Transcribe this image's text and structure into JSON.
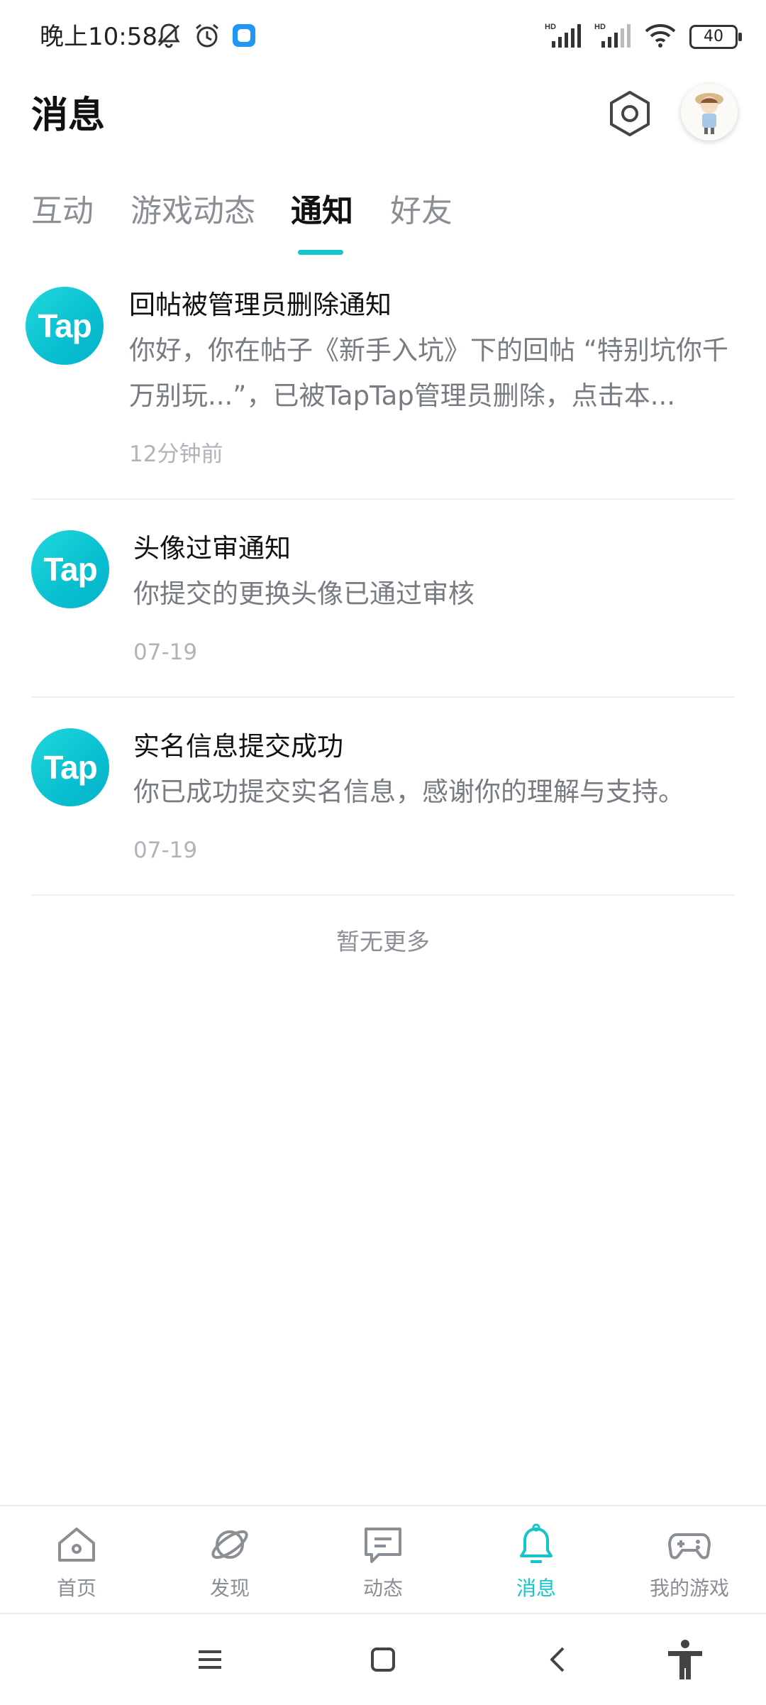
{
  "status_bar": {
    "time": "晚上10:58",
    "left_icons": [
      "bell-off-icon",
      "alarm-icon",
      "app-notification-icon"
    ],
    "right_icons": [
      "hd-signal-1-icon",
      "hd-signal-2-icon",
      "wifi-icon"
    ],
    "battery": "40"
  },
  "header": {
    "title": "消息",
    "settings_icon": "settings-hexagon-icon",
    "avatar": "user-avatar"
  },
  "tabs": [
    {
      "label": "互动",
      "active": false
    },
    {
      "label": "游戏动态",
      "active": false
    },
    {
      "label": "通知",
      "active": true
    },
    {
      "label": "好友",
      "active": false
    }
  ],
  "notifications": [
    {
      "logo": "Tap",
      "title": "回帖被管理员删除通知",
      "body": "你好，你在帖子《新手入坑》下的回帖 “特别坑你千万别玩...”，已被TapTap管理员删除，点击本...",
      "time": "12分钟前"
    },
    {
      "logo": "Tap",
      "title": "头像过审通知",
      "body": "你提交的更换头像已通过审核",
      "time": "07-19"
    },
    {
      "logo": "Tap",
      "title": "实名信息提交成功",
      "body": "你已成功提交实名信息，感谢你的理解与支持。",
      "time": "07-19"
    }
  ],
  "footer_text": "暂无更多",
  "bottom_nav": [
    {
      "label": "首页",
      "icon": "home-icon",
      "active": false
    },
    {
      "label": "发现",
      "icon": "planet-icon",
      "active": false
    },
    {
      "label": "动态",
      "icon": "chat-icon",
      "active": false
    },
    {
      "label": "消息",
      "icon": "bell-icon",
      "active": true
    },
    {
      "label": "我的游戏",
      "icon": "gamepad-icon",
      "active": false
    }
  ],
  "system_nav": [
    "menu-icon",
    "home-square-icon",
    "back-icon",
    "accessibility-icon"
  ],
  "colors": {
    "accent": "#15c5ce",
    "text_primary": "#111111",
    "text_secondary": "#777b82",
    "text_muted": "#b0b4ba"
  }
}
